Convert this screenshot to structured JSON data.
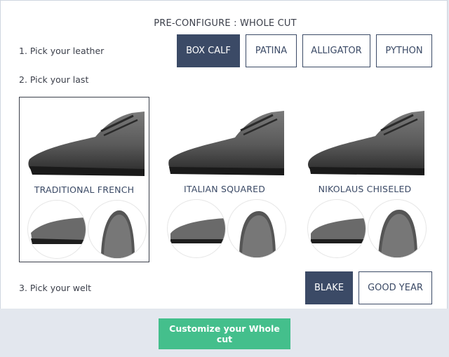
{
  "title": "PRE-CONFIGURE : WHOLE CUT",
  "steps": {
    "leather": {
      "label": "1. Pick your leather",
      "options": [
        "BOX CALF",
        "PATINA",
        "ALLIGATOR",
        "PYTHON"
      ],
      "selected": "BOX CALF"
    },
    "last": {
      "label": "2. Pick your last",
      "options": [
        "TRADITIONAL FRENCH",
        "ITALIAN SQUARED",
        "NIKOLAUS CHISELED"
      ],
      "selected": "TRADITIONAL FRENCH"
    },
    "welt": {
      "label": "3. Pick your welt",
      "options": [
        "BLAKE",
        "GOOD YEAR"
      ],
      "selected": "BLAKE"
    }
  },
  "cta": {
    "label": "Customize your Whole cut"
  },
  "colors": {
    "navy": "#3b4a66",
    "green": "#44bf8c",
    "footer_bg": "#e3e7ee"
  }
}
